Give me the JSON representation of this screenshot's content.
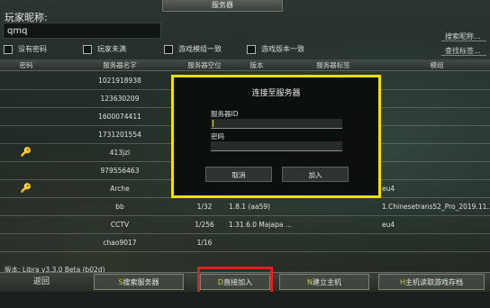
{
  "window": {
    "title": "服务器"
  },
  "player": {
    "label": "玩家昵称:",
    "name": "qmq"
  },
  "search": {
    "nickname": "搜索昵称...",
    "tags": "查找标签..."
  },
  "filters": [
    {
      "label": "没有密码"
    },
    {
      "label": "玩家未满"
    },
    {
      "label": "游戏模组一致"
    },
    {
      "label": "游戏版本一致"
    }
  ],
  "columns": {
    "password": "密码",
    "name": "服务器名字",
    "slots": "服务器空位",
    "version": "版本",
    "tags": "服务器标签",
    "mods": "模组"
  },
  "rows": [
    {
      "locked": false,
      "name": "1021918938",
      "slots": "",
      "version": "",
      "tags": "",
      "mods": ""
    },
    {
      "locked": false,
      "name": "123630209",
      "slots": "",
      "version": "",
      "tags": "",
      "mods": ""
    },
    {
      "locked": false,
      "name": "1600074411",
      "slots": "",
      "version": "",
      "tags": "",
      "mods": ""
    },
    {
      "locked": false,
      "name": "1731201554",
      "slots": "",
      "version": "",
      "tags": "",
      "mods": ""
    },
    {
      "locked": true,
      "name": "413jzl",
      "slots": "",
      "version": "",
      "tags": "",
      "mods": ""
    },
    {
      "locked": false,
      "name": "979556463",
      "slots": "",
      "version": "",
      "tags": "",
      "mods": ""
    },
    {
      "locked": true,
      "name": "Arche",
      "slots": "",
      "version": "",
      "tags": "",
      "mods": "eu4"
    },
    {
      "locked": false,
      "name": "bb",
      "slots": "1/32",
      "version": "1.8.1 (aa59)",
      "tags": "",
      "mods": "1.Chinesetrans52_Pro_2019.11.30 ..."
    },
    {
      "locked": false,
      "name": "CCTV",
      "slots": "1/256",
      "version": "1.31.6.0 Majapa ...",
      "tags": "",
      "mods": "eu4"
    },
    {
      "locked": false,
      "name": "chao9017",
      "slots": "1/16",
      "version": "",
      "tags": "",
      "mods": ""
    }
  ],
  "dialog": {
    "title": "连接至服务器",
    "server_id_label": "服务器ID",
    "server_id_value": "",
    "password_label": "密码",
    "password_value": "",
    "cancel": "取消",
    "join": "加入"
  },
  "version_text": "版本: Libra v3.3.0 Beta (b02d)",
  "bottom": {
    "back": "返回",
    "search_hot": "S",
    "search": "搜索服务器",
    "direct_hot": "D",
    "direct": "直接加入",
    "host_hot": "N",
    "host": "建立主机",
    "load_hot": "H",
    "load": "主机读取游戏存档"
  },
  "colors": {
    "highlight_modal": "#f0e000",
    "highlight_button": "#e02020",
    "hotkey": "#e2c24a"
  }
}
